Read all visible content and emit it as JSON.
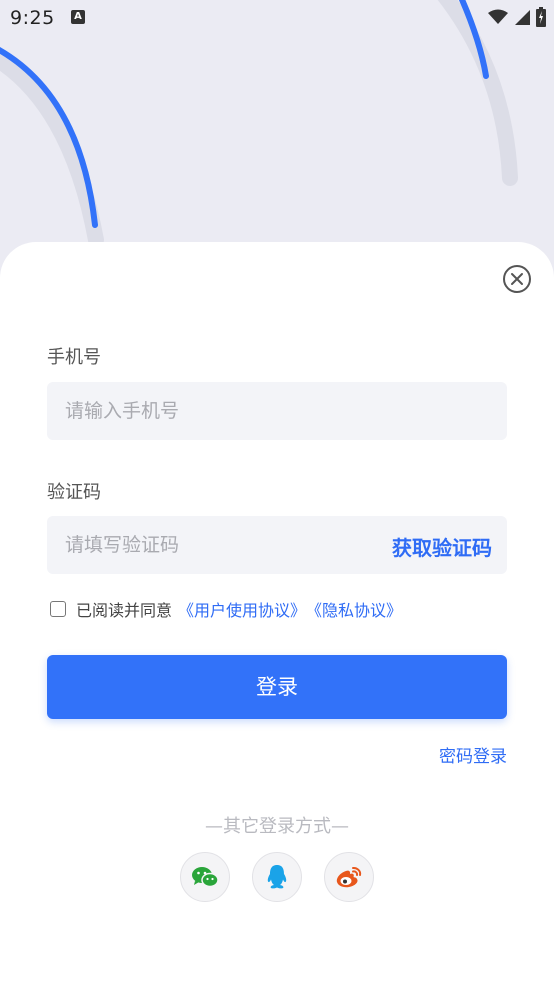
{
  "status_bar": {
    "time": "9:25",
    "notification_icon": "a-icon",
    "notification_glyph": "A",
    "right_icons": [
      "wifi-icon",
      "signal-icon",
      "battery-icon"
    ]
  },
  "login": {
    "close_icon": "close-circle-icon",
    "phone_label": "手机号",
    "phone_placeholder": "请输入手机号",
    "phone_value": "",
    "code_label": "验证码",
    "code_placeholder": "请填写验证码",
    "code_value": "",
    "get_code_label": "获取验证码",
    "agree_prefix": "已阅读并同意",
    "user_agreement_link": "《用户使用协议》",
    "privacy_link": "《隐私协议》",
    "agree_checked": false,
    "login_button": "登录",
    "password_login_link": "密码登录",
    "other_methods_title": "—其它登录方式—",
    "social": [
      {
        "name": "wechat-icon",
        "color": "#2aa53a"
      },
      {
        "name": "qq-icon",
        "color": "#1aa3e8"
      },
      {
        "name": "weibo-icon",
        "color": "#e8571c"
      }
    ]
  },
  "colors": {
    "accent": "#3272f9",
    "link": "#2f6cf5",
    "input_bg": "#f3f4f8",
    "background": "#ebebf3"
  }
}
